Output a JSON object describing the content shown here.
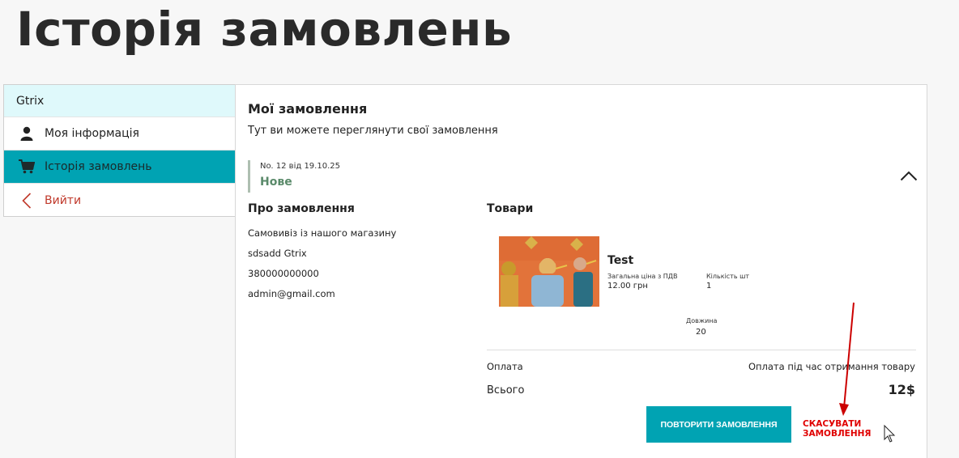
{
  "page": {
    "title": "Історія замовлень"
  },
  "sidebar": {
    "header": "Gtrix",
    "items": [
      {
        "label": "Моя інформація",
        "icon": "user-icon",
        "active": false
      },
      {
        "label": "Історія замовлень",
        "icon": "cart-icon",
        "active": true
      },
      {
        "label": "Вийти",
        "icon": "chevron-left-icon",
        "active": false
      }
    ]
  },
  "main": {
    "title": "Мої замовлення",
    "subtitle": "Тут ви можете переглянути свої замовлення"
  },
  "order": {
    "number_date": "No. 12 від 19.10.25",
    "status": "Нове",
    "about_title": "Про замовлення",
    "about": [
      "Самовивіз із нашого магазину",
      "sdsadd Gtrix",
      "380000000000",
      "admin@gmail.com"
    ],
    "goods_title": "Товари",
    "product": {
      "name": "Test",
      "price_label": "Загальна ціна з ПДВ",
      "price": "12.00 грн",
      "qty_label": "Кількість шт",
      "qty": "1",
      "length_label": "Довжина",
      "length": "20"
    },
    "payment_label": "Оплата",
    "payment_value": "Оплата під час отримання товару",
    "total_label": "Всього",
    "total_value": "12$",
    "repeat_button": "ПОВТОРИТИ ЗАМОВЛЕННЯ",
    "cancel_button": "СКАСУВАТИ ЗАМОВЛЕННЯ"
  },
  "colors": {
    "accent": "#00a3b3",
    "sidebar_header_bg": "#dff9fb",
    "status": "#5a8a6a",
    "cancel": "#e00000",
    "annotation_arrow": "#cc0000"
  }
}
